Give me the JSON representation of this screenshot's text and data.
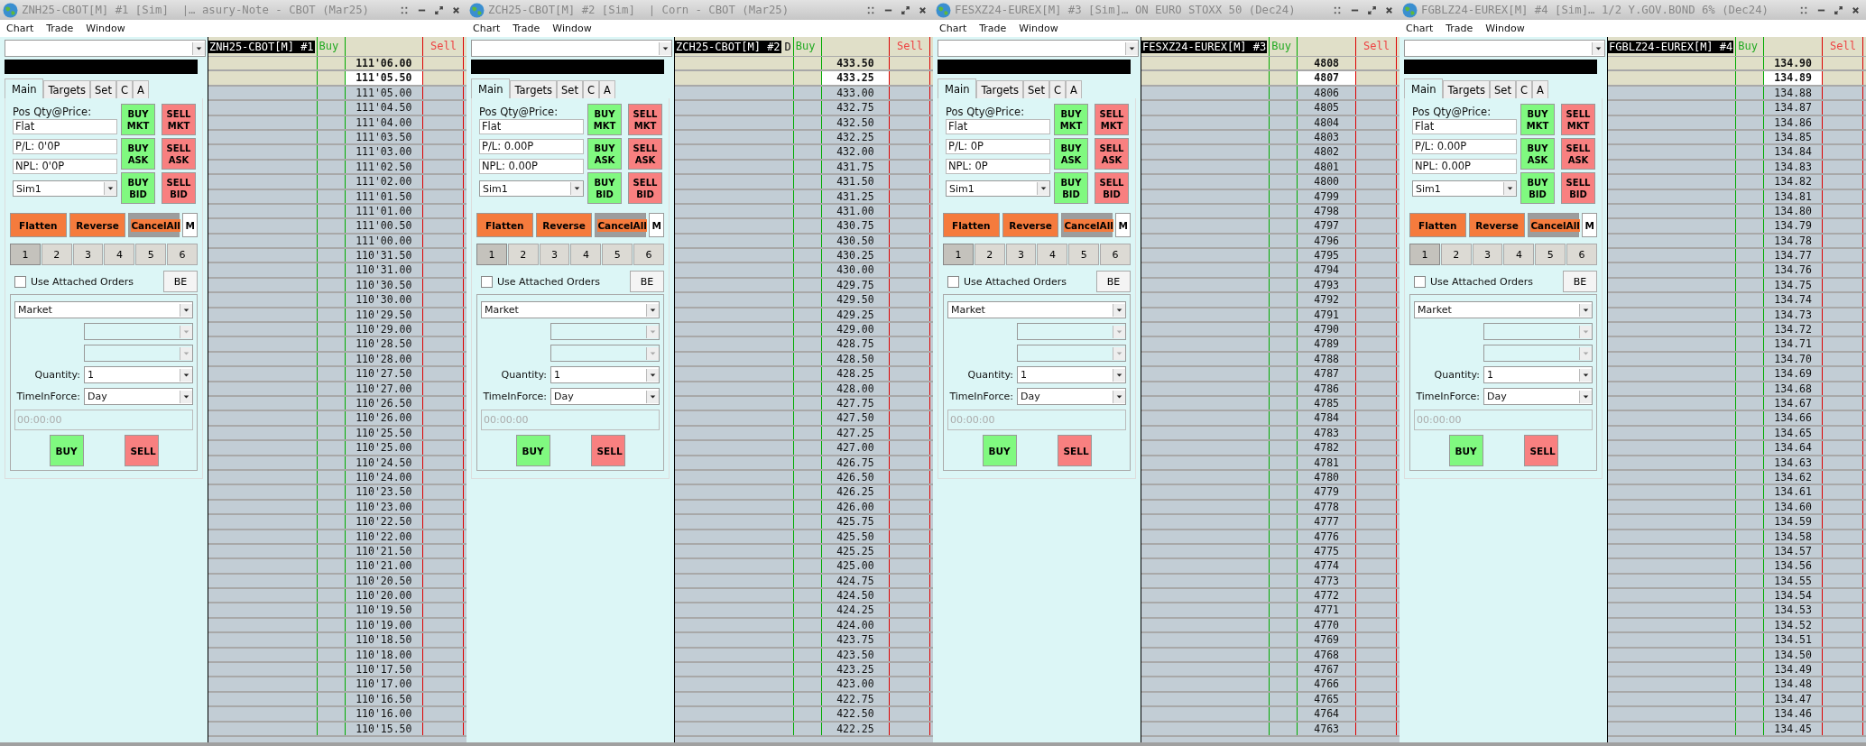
{
  "windows": [
    {
      "title": "ZNH25-CBOT[M] #1 [Sim]  |… asury-Note - CBOT (Mar25)",
      "menu": [
        "Chart",
        "Trade",
        "Window"
      ],
      "tabs": [
        {
          "label": "Main",
          "selected": true
        },
        {
          "label": "Targets",
          "selected": false
        },
        {
          "label": "Set",
          "selected": false
        },
        {
          "label": "C",
          "selected": false
        },
        {
          "label": "A",
          "selected": false
        }
      ],
      "position_label": "Pos Qty@Price:",
      "position": "Flat",
      "pl": "P/L: 0'0P",
      "npl": "NPL: 0'0P",
      "account": "Sim1",
      "quick": [
        {
          "label": "BUY MKT",
          "kind": "buy"
        },
        {
          "label": "SELL MKT",
          "kind": "sell"
        },
        {
          "label": "BUY ASK",
          "kind": "buy"
        },
        {
          "label": "SELL ASK",
          "kind": "sell"
        },
        {
          "label": "BUY BID",
          "kind": "buy"
        },
        {
          "label": "SELL BID",
          "kind": "sell"
        }
      ],
      "actions": [
        {
          "label": "Flatten",
          "kind": "flatten"
        },
        {
          "label": "Reverse",
          "kind": "reverse"
        },
        {
          "label": "CancelAll",
          "kind": "cancel"
        },
        {
          "label": "M",
          "kind": "plain"
        }
      ],
      "pages": [
        {
          "label": "1",
          "selected": true
        },
        {
          "label": "2",
          "selected": false
        },
        {
          "label": "3",
          "selected": false
        },
        {
          "label": "4",
          "selected": false
        },
        {
          "label": "5",
          "selected": false
        },
        {
          "label": "6",
          "selected": false
        }
      ],
      "attached": {
        "label": "Use Attached Orders",
        "checked": false
      },
      "be": "BE",
      "order_type": "Market",
      "quantity_label": "Quantity:",
      "quantity": "1",
      "tif_label": "TimeInForce:",
      "tif": "Day",
      "time_placeholder": "00:00:00",
      "buy": "BUY",
      "sell": "SELL",
      "ladder": {
        "label": "ZNH25-CBOT[M] #1",
        "buy_header": "Buy",
        "sell_header": "Sell",
        "rows": [
          {
            "price": "111'06.00",
            "kind": "above"
          },
          {
            "price": "111'05.50",
            "kind": "last"
          },
          {
            "price": "111'05.00",
            "kind": "below"
          },
          {
            "price": "111'04.50",
            "kind": "below"
          },
          {
            "price": "111'04.00",
            "kind": "below"
          },
          {
            "price": "111'03.50",
            "kind": "below"
          },
          {
            "price": "111'03.00",
            "kind": "below"
          },
          {
            "price": "111'02.50",
            "kind": "below"
          },
          {
            "price": "111'02.00",
            "kind": "below"
          },
          {
            "price": "111'01.50",
            "kind": "below"
          },
          {
            "price": "111'01.00",
            "kind": "below"
          },
          {
            "price": "111'00.50",
            "kind": "below"
          },
          {
            "price": "111'00.00",
            "kind": "below"
          },
          {
            "price": "110'31.50",
            "kind": "below"
          },
          {
            "price": "110'31.00",
            "kind": "below"
          },
          {
            "price": "110'30.50",
            "kind": "below"
          },
          {
            "price": "110'30.00",
            "kind": "below"
          },
          {
            "price": "110'29.50",
            "kind": "below"
          },
          {
            "price": "110'29.00",
            "kind": "below"
          },
          {
            "price": "110'28.50",
            "kind": "below"
          },
          {
            "price": "110'28.00",
            "kind": "below"
          },
          {
            "price": "110'27.50",
            "kind": "below"
          },
          {
            "price": "110'27.00",
            "kind": "below"
          },
          {
            "price": "110'26.50",
            "kind": "below"
          },
          {
            "price": "110'26.00",
            "kind": "below"
          },
          {
            "price": "110'25.50",
            "kind": "below"
          },
          {
            "price": "110'25.00",
            "kind": "below"
          },
          {
            "price": "110'24.50",
            "kind": "below"
          },
          {
            "price": "110'24.00",
            "kind": "below"
          },
          {
            "price": "110'23.50",
            "kind": "below"
          },
          {
            "price": "110'23.00",
            "kind": "below"
          },
          {
            "price": "110'22.50",
            "kind": "below"
          },
          {
            "price": "110'22.00",
            "kind": "below"
          },
          {
            "price": "110'21.50",
            "kind": "below"
          },
          {
            "price": "110'21.00",
            "kind": "below"
          },
          {
            "price": "110'20.50",
            "kind": "below"
          },
          {
            "price": "110'20.00",
            "kind": "below"
          },
          {
            "price": "110'19.50",
            "kind": "below"
          },
          {
            "price": "110'19.00",
            "kind": "below"
          },
          {
            "price": "110'18.50",
            "kind": "below"
          },
          {
            "price": "110'18.00",
            "kind": "below"
          },
          {
            "price": "110'17.50",
            "kind": "below"
          },
          {
            "price": "110'17.00",
            "kind": "below"
          },
          {
            "price": "110'16.50",
            "kind": "below"
          },
          {
            "price": "110'16.00",
            "kind": "below"
          },
          {
            "price": "110'15.50",
            "kind": "below"
          }
        ]
      }
    },
    {
      "title": "ZCH25-CBOT[M] #2 [Sim]  | Corn - CBOT (Mar25)",
      "menu": [
        "Chart",
        "Trade",
        "Window"
      ],
      "tabs": [
        {
          "label": "Main",
          "selected": true
        },
        {
          "label": "Targets",
          "selected": false
        },
        {
          "label": "Set",
          "selected": false
        },
        {
          "label": "C",
          "selected": false
        },
        {
          "label": "A",
          "selected": false
        }
      ],
      "position_label": "Pos Qty@Price:",
      "position": "Flat",
      "pl": "P/L: 0.00P",
      "npl": "NPL: 0.00P",
      "account": "Sim1",
      "quick": [
        {
          "label": "BUY MKT",
          "kind": "buy"
        },
        {
          "label": "SELL MKT",
          "kind": "sell"
        },
        {
          "label": "BUY ASK",
          "kind": "buy"
        },
        {
          "label": "SELL ASK",
          "kind": "sell"
        },
        {
          "label": "BUY BID",
          "kind": "buy"
        },
        {
          "label": "SELL BID",
          "kind": "sell"
        }
      ],
      "actions": [
        {
          "label": "Flatten",
          "kind": "flatten"
        },
        {
          "label": "Reverse",
          "kind": "reverse"
        },
        {
          "label": "CancelAll",
          "kind": "cancel"
        },
        {
          "label": "M",
          "kind": "plain"
        }
      ],
      "pages": [
        {
          "label": "1",
          "selected": true
        },
        {
          "label": "2",
          "selected": false
        },
        {
          "label": "3",
          "selected": false
        },
        {
          "label": "4",
          "selected": false
        },
        {
          "label": "5",
          "selected": false
        },
        {
          "label": "6",
          "selected": false
        }
      ],
      "attached": {
        "label": "Use Attached Orders",
        "checked": false
      },
      "be": "BE",
      "order_type": "Market",
      "quantity_label": "Quantity:",
      "quantity": "1",
      "tif_label": "TimeInForce:",
      "tif": "Day",
      "time_placeholder": "00:00:00",
      "buy": "BUY",
      "sell": "SELL",
      "ladder": {
        "label": "ZCH25-CBOT[M] #2",
        "note": "D",
        "buy_header": "Buy",
        "sell_header": "Sell",
        "rows": [
          {
            "price": "433.50",
            "kind": "above"
          },
          {
            "price": "433.25",
            "kind": "last"
          },
          {
            "price": "433.00",
            "kind": "below"
          },
          {
            "price": "432.75",
            "kind": "below"
          },
          {
            "price": "432.50",
            "kind": "below"
          },
          {
            "price": "432.25",
            "kind": "below"
          },
          {
            "price": "432.00",
            "kind": "below"
          },
          {
            "price": "431.75",
            "kind": "below"
          },
          {
            "price": "431.50",
            "kind": "below"
          },
          {
            "price": "431.25",
            "kind": "below"
          },
          {
            "price": "431.00",
            "kind": "below"
          },
          {
            "price": "430.75",
            "kind": "below"
          },
          {
            "price": "430.50",
            "kind": "below"
          },
          {
            "price": "430.25",
            "kind": "below"
          },
          {
            "price": "430.00",
            "kind": "below"
          },
          {
            "price": "429.75",
            "kind": "below"
          },
          {
            "price": "429.50",
            "kind": "below"
          },
          {
            "price": "429.25",
            "kind": "below"
          },
          {
            "price": "429.00",
            "kind": "below"
          },
          {
            "price": "428.75",
            "kind": "below"
          },
          {
            "price": "428.50",
            "kind": "below"
          },
          {
            "price": "428.25",
            "kind": "below"
          },
          {
            "price": "428.00",
            "kind": "below"
          },
          {
            "price": "427.75",
            "kind": "below"
          },
          {
            "price": "427.50",
            "kind": "below"
          },
          {
            "price": "427.25",
            "kind": "below"
          },
          {
            "price": "427.00",
            "kind": "below"
          },
          {
            "price": "426.75",
            "kind": "below"
          },
          {
            "price": "426.50",
            "kind": "below"
          },
          {
            "price": "426.25",
            "kind": "below"
          },
          {
            "price": "426.00",
            "kind": "below"
          },
          {
            "price": "425.75",
            "kind": "below"
          },
          {
            "price": "425.50",
            "kind": "below"
          },
          {
            "price": "425.25",
            "kind": "below"
          },
          {
            "price": "425.00",
            "kind": "below"
          },
          {
            "price": "424.75",
            "kind": "below"
          },
          {
            "price": "424.50",
            "kind": "below"
          },
          {
            "price": "424.25",
            "kind": "below"
          },
          {
            "price": "424.00",
            "kind": "below"
          },
          {
            "price": "423.75",
            "kind": "below"
          },
          {
            "price": "423.50",
            "kind": "below"
          },
          {
            "price": "423.25",
            "kind": "below"
          },
          {
            "price": "423.00",
            "kind": "below"
          },
          {
            "price": "422.75",
            "kind": "below"
          },
          {
            "price": "422.50",
            "kind": "below"
          },
          {
            "price": "422.25",
            "kind": "below"
          }
        ]
      }
    },
    {
      "title": "FESXZ24-EUREX[M] #3 [Sim]… ON EURO STOXX 50 (Dec24)",
      "menu": [
        "Chart",
        "Trade",
        "Window"
      ],
      "tabs": [
        {
          "label": "Main",
          "selected": true
        },
        {
          "label": "Targets",
          "selected": false
        },
        {
          "label": "Set",
          "selected": false
        },
        {
          "label": "C",
          "selected": false
        },
        {
          "label": "A",
          "selected": false
        }
      ],
      "position_label": "Pos Qty@Price:",
      "position": "Flat",
      "pl": "P/L: 0P",
      "npl": "NPL: 0P",
      "account": "Sim1",
      "quick": [
        {
          "label": "BUY MKT",
          "kind": "buy"
        },
        {
          "label": "SELL MKT",
          "kind": "sell"
        },
        {
          "label": "BUY ASK",
          "kind": "buy"
        },
        {
          "label": "SELL ASK",
          "kind": "sell"
        },
        {
          "label": "BUY BID",
          "kind": "buy"
        },
        {
          "label": "SELL BID",
          "kind": "sell"
        }
      ],
      "actions": [
        {
          "label": "Flatten",
          "kind": "flatten"
        },
        {
          "label": "Reverse",
          "kind": "reverse"
        },
        {
          "label": "CancelAll",
          "kind": "cancel"
        },
        {
          "label": "M",
          "kind": "plain"
        }
      ],
      "pages": [
        {
          "label": "1",
          "selected": true
        },
        {
          "label": "2",
          "selected": false
        },
        {
          "label": "3",
          "selected": false
        },
        {
          "label": "4",
          "selected": false
        },
        {
          "label": "5",
          "selected": false
        },
        {
          "label": "6",
          "selected": false
        }
      ],
      "attached": {
        "label": "Use Attached Orders",
        "checked": false
      },
      "be": "BE",
      "order_type": "Market",
      "quantity_label": "Quantity:",
      "quantity": "1",
      "tif_label": "TimeInForce:",
      "tif": "Day",
      "time_placeholder": "00:00:00",
      "buy": "BUY",
      "sell": "SELL",
      "ladder": {
        "label": "FESXZ24-EUREX[M] #3",
        "buy_header": "Buy",
        "sell_header": "Sell",
        "rows": [
          {
            "price": "4808",
            "kind": "above"
          },
          {
            "price": "4807",
            "kind": "last"
          },
          {
            "price": "4806",
            "kind": "below"
          },
          {
            "price": "4805",
            "kind": "below"
          },
          {
            "price": "4804",
            "kind": "below"
          },
          {
            "price": "4803",
            "kind": "below"
          },
          {
            "price": "4802",
            "kind": "below"
          },
          {
            "price": "4801",
            "kind": "below"
          },
          {
            "price": "4800",
            "kind": "below"
          },
          {
            "price": "4799",
            "kind": "below"
          },
          {
            "price": "4798",
            "kind": "below"
          },
          {
            "price": "4797",
            "kind": "below"
          },
          {
            "price": "4796",
            "kind": "below"
          },
          {
            "price": "4795",
            "kind": "below"
          },
          {
            "price": "4794",
            "kind": "below"
          },
          {
            "price": "4793",
            "kind": "below"
          },
          {
            "price": "4792",
            "kind": "below"
          },
          {
            "price": "4791",
            "kind": "below"
          },
          {
            "price": "4790",
            "kind": "below"
          },
          {
            "price": "4789",
            "kind": "below"
          },
          {
            "price": "4788",
            "kind": "below"
          },
          {
            "price": "4787",
            "kind": "below"
          },
          {
            "price": "4786",
            "kind": "below"
          },
          {
            "price": "4785",
            "kind": "below"
          },
          {
            "price": "4784",
            "kind": "below"
          },
          {
            "price": "4783",
            "kind": "below"
          },
          {
            "price": "4782",
            "kind": "below"
          },
          {
            "price": "4781",
            "kind": "below"
          },
          {
            "price": "4780",
            "kind": "below"
          },
          {
            "price": "4779",
            "kind": "below"
          },
          {
            "price": "4778",
            "kind": "below"
          },
          {
            "price": "4777",
            "kind": "below"
          },
          {
            "price": "4776",
            "kind": "below"
          },
          {
            "price": "4775",
            "kind": "below"
          },
          {
            "price": "4774",
            "kind": "below"
          },
          {
            "price": "4773",
            "kind": "below"
          },
          {
            "price": "4772",
            "kind": "below"
          },
          {
            "price": "4771",
            "kind": "below"
          },
          {
            "price": "4770",
            "kind": "below"
          },
          {
            "price": "4769",
            "kind": "below"
          },
          {
            "price": "4768",
            "kind": "below"
          },
          {
            "price": "4767",
            "kind": "below"
          },
          {
            "price": "4766",
            "kind": "below"
          },
          {
            "price": "4765",
            "kind": "below"
          },
          {
            "price": "4764",
            "kind": "below"
          },
          {
            "price": "4763",
            "kind": "below"
          }
        ]
      }
    },
    {
      "title": "FGBLZ24-EUREX[M] #4 [Sim]… 1/2 Y.GOV.BOND 6% (Dec24)",
      "menu": [
        "Chart",
        "Trade",
        "Window"
      ],
      "tabs": [
        {
          "label": "Main",
          "selected": true
        },
        {
          "label": "Targets",
          "selected": false
        },
        {
          "label": "Set",
          "selected": false
        },
        {
          "label": "C",
          "selected": false
        },
        {
          "label": "A",
          "selected": false
        }
      ],
      "position_label": "Pos Qty@Price:",
      "position": "Flat",
      "pl": "P/L: 0.00P",
      "npl": "NPL: 0.00P",
      "account": "Sim1",
      "quick": [
        {
          "label": "BUY MKT",
          "kind": "buy"
        },
        {
          "label": "SELL MKT",
          "kind": "sell"
        },
        {
          "label": "BUY ASK",
          "kind": "buy"
        },
        {
          "label": "SELL ASK",
          "kind": "sell"
        },
        {
          "label": "BUY BID",
          "kind": "buy"
        },
        {
          "label": "SELL BID",
          "kind": "sell"
        }
      ],
      "actions": [
        {
          "label": "Flatten",
          "kind": "flatten"
        },
        {
          "label": "Reverse",
          "kind": "reverse"
        },
        {
          "label": "CancelAll",
          "kind": "cancel"
        },
        {
          "label": "M",
          "kind": "plain"
        }
      ],
      "pages": [
        {
          "label": "1",
          "selected": true
        },
        {
          "label": "2",
          "selected": false
        },
        {
          "label": "3",
          "selected": false
        },
        {
          "label": "4",
          "selected": false
        },
        {
          "label": "5",
          "selected": false
        },
        {
          "label": "6",
          "selected": false
        }
      ],
      "attached": {
        "label": "Use Attached Orders",
        "checked": false
      },
      "be": "BE",
      "order_type": "Market",
      "quantity_label": "Quantity:",
      "quantity": "1",
      "tif_label": "TimeInForce:",
      "tif": "Day",
      "time_placeholder": "00:00:00",
      "buy": "BUY",
      "sell": "SELL",
      "ladder": {
        "label": "FGBLZ24-EUREX[M] #4",
        "buy_header": "Buy",
        "sell_header": "Sell",
        "rows": [
          {
            "price": "134.90",
            "kind": "above"
          },
          {
            "price": "134.89",
            "kind": "last"
          },
          {
            "price": "134.88",
            "kind": "below"
          },
          {
            "price": "134.87",
            "kind": "below"
          },
          {
            "price": "134.86",
            "kind": "below"
          },
          {
            "price": "134.85",
            "kind": "below"
          },
          {
            "price": "134.84",
            "kind": "below"
          },
          {
            "price": "134.83",
            "kind": "below"
          },
          {
            "price": "134.82",
            "kind": "below"
          },
          {
            "price": "134.81",
            "kind": "below"
          },
          {
            "price": "134.80",
            "kind": "below"
          },
          {
            "price": "134.79",
            "kind": "below"
          },
          {
            "price": "134.78",
            "kind": "below"
          },
          {
            "price": "134.77",
            "kind": "below"
          },
          {
            "price": "134.76",
            "kind": "below"
          },
          {
            "price": "134.75",
            "kind": "below"
          },
          {
            "price": "134.74",
            "kind": "below"
          },
          {
            "price": "134.73",
            "kind": "below"
          },
          {
            "price": "134.72",
            "kind": "below"
          },
          {
            "price": "134.71",
            "kind": "below"
          },
          {
            "price": "134.70",
            "kind": "below"
          },
          {
            "price": "134.69",
            "kind": "below"
          },
          {
            "price": "134.68",
            "kind": "below"
          },
          {
            "price": "134.67",
            "kind": "below"
          },
          {
            "price": "134.66",
            "kind": "below"
          },
          {
            "price": "134.65",
            "kind": "below"
          },
          {
            "price": "134.64",
            "kind": "below"
          },
          {
            "price": "134.63",
            "kind": "below"
          },
          {
            "price": "134.62",
            "kind": "below"
          },
          {
            "price": "134.61",
            "kind": "below"
          },
          {
            "price": "134.60",
            "kind": "below"
          },
          {
            "price": "134.59",
            "kind": "below"
          },
          {
            "price": "134.58",
            "kind": "below"
          },
          {
            "price": "134.57",
            "kind": "below"
          },
          {
            "price": "134.56",
            "kind": "below"
          },
          {
            "price": "134.55",
            "kind": "below"
          },
          {
            "price": "134.54",
            "kind": "below"
          },
          {
            "price": "134.53",
            "kind": "below"
          },
          {
            "price": "134.52",
            "kind": "below"
          },
          {
            "price": "134.51",
            "kind": "below"
          },
          {
            "price": "134.50",
            "kind": "below"
          },
          {
            "price": "134.49",
            "kind": "below"
          },
          {
            "price": "134.48",
            "kind": "below"
          },
          {
            "price": "134.47",
            "kind": "below"
          },
          {
            "price": "134.46",
            "kind": "below"
          },
          {
            "price": "134.45",
            "kind": "below"
          }
        ]
      }
    }
  ]
}
